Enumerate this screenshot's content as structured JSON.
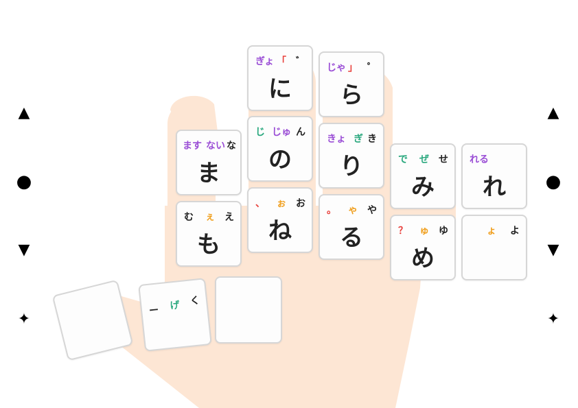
{
  "colors": {
    "purple": "#9b4fd6",
    "green": "#2aa87e",
    "orange": "#f0a020",
    "red": "#e8413c",
    "black": "#222222",
    "hand": "#fde6d4"
  },
  "side_markers": [
    "▲",
    "●",
    "▼",
    "✦"
  ],
  "keys": [
    {
      "id": "ni",
      "main": "に",
      "tl": {
        "t": "ぎょ",
        "c": "purple"
      },
      "tm": {
        "t": "「",
        "c": "red"
      },
      "tr": {
        "t": "゛",
        "c": "black"
      }
    },
    {
      "id": "ra",
      "main": "ら",
      "tl": {
        "t": "じゃ",
        "c": "purple"
      },
      "tm": {
        "t": "」",
        "c": "red"
      },
      "tr": {
        "t": "゜",
        "c": "black"
      }
    },
    {
      "id": "ma",
      "main": "ま",
      "tl": {
        "t": "ます",
        "c": "purple"
      },
      "tm": {
        "t": "ない",
        "c": "purple"
      },
      "tr": {
        "t": "な",
        "c": "black"
      }
    },
    {
      "id": "no",
      "main": "の",
      "tl": {
        "t": "じ",
        "c": "green"
      },
      "tm": {
        "t": "じゅ",
        "c": "purple"
      },
      "tr": {
        "t": "ん",
        "c": "black"
      }
    },
    {
      "id": "ri",
      "main": "り",
      "tl": {
        "t": "きょ",
        "c": "purple"
      },
      "tm": {
        "t": "ぎ",
        "c": "green"
      },
      "tr": {
        "t": "き",
        "c": "black"
      }
    },
    {
      "id": "mi",
      "main": "み",
      "tl": {
        "t": "で",
        "c": "green"
      },
      "tm": {
        "t": "ぜ",
        "c": "green"
      },
      "tr": {
        "t": "せ",
        "c": "black"
      }
    },
    {
      "id": "re",
      "main": "れ",
      "tl": {
        "t": "れる",
        "c": "purple"
      },
      "tm": {
        "t": "",
        "c": "black"
      },
      "tr": {
        "t": "",
        "c": "black"
      }
    },
    {
      "id": "mo",
      "main": "も",
      "tl": {
        "t": "む",
        "c": "black"
      },
      "tm": {
        "t": "ぇ",
        "c": "orange"
      },
      "tr": {
        "t": "え",
        "c": "black"
      }
    },
    {
      "id": "ne",
      "main": "ね",
      "tl": {
        "t": "、",
        "c": "red"
      },
      "tm": {
        "t": "ぉ",
        "c": "orange"
      },
      "tr": {
        "t": "お",
        "c": "black"
      }
    },
    {
      "id": "ru",
      "main": "る",
      "tl": {
        "t": "。",
        "c": "red"
      },
      "tm": {
        "t": "ゃ",
        "c": "orange"
      },
      "tr": {
        "t": "や",
        "c": "black"
      }
    },
    {
      "id": "me",
      "main": "め",
      "tl": {
        "t": "？",
        "c": "red"
      },
      "tm": {
        "t": "ゅ",
        "c": "orange"
      },
      "tr": {
        "t": "ゆ",
        "c": "black"
      }
    },
    {
      "id": "yo",
      "main": "",
      "tl": {
        "t": "",
        "c": "black"
      },
      "tm": {
        "t": "ょ",
        "c": "orange"
      },
      "tr": {
        "t": "よ",
        "c": "black"
      }
    },
    {
      "id": "thumb1",
      "main": "",
      "tl": {
        "t": "",
        "c": "black"
      },
      "tm": {
        "t": "",
        "c": "black"
      },
      "tr": {
        "t": "",
        "c": "black"
      }
    },
    {
      "id": "thumb2",
      "main": "",
      "tl": {
        "t": "ー",
        "c": "black"
      },
      "tm": {
        "t": "げ",
        "c": "green"
      },
      "tr": {
        "t": "く",
        "c": "black"
      }
    },
    {
      "id": "thumb3",
      "main": "",
      "tl": {
        "t": "",
        "c": "black"
      },
      "tm": {
        "t": "",
        "c": "black"
      },
      "tr": {
        "t": "",
        "c": "black"
      }
    }
  ]
}
